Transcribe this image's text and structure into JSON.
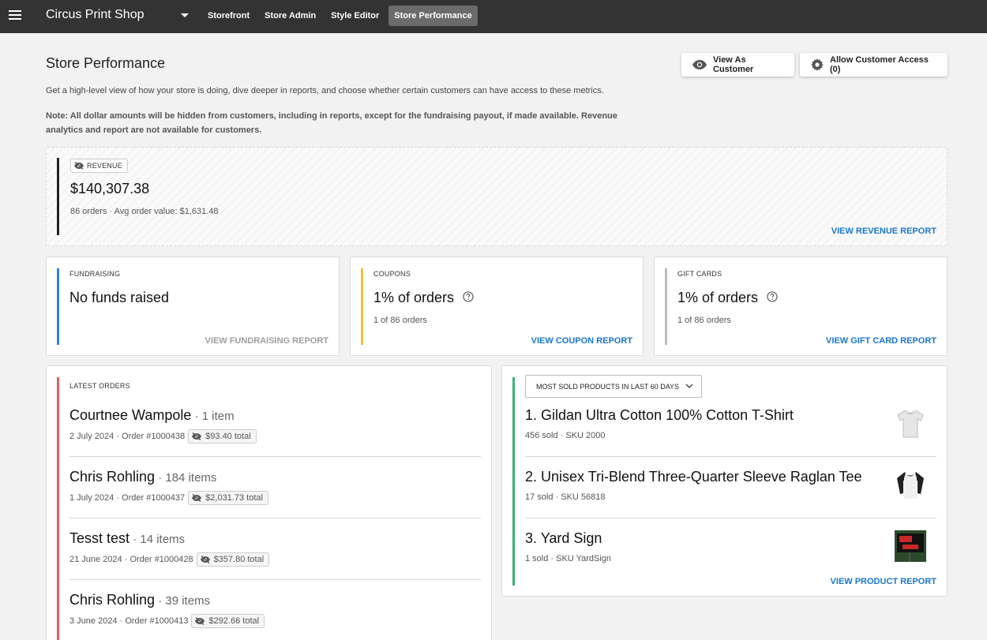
{
  "topbar": {
    "shop_name": "Circus Print Shop",
    "nav": [
      "Storefront",
      "Store Admin",
      "Style Editor",
      "Store Performance"
    ],
    "active_nav": "Store Performance"
  },
  "header": {
    "title": "Store Performance",
    "view_as_customer": "View As Customer",
    "allow_access": "Allow Customer Access (0)",
    "description": "Get a high-level view of how your store is doing, dive deeper in reports, and choose whether certain customers can have access to these metrics.",
    "note": "Note: All dollar amounts will be hidden from customers, including in reports, except for the fundraising payout, if made available. Revenue analytics and report are not available for customers."
  },
  "revenue": {
    "label": "REVENUE",
    "amount": "$140,307.38",
    "sub": "86 orders · Avg order value: $1,631.48",
    "link": "VIEW REVENUE REPORT"
  },
  "fundraising": {
    "label": "FUNDRAISING",
    "value": "No funds raised",
    "link": "VIEW FUNDRAISING REPORT"
  },
  "coupons": {
    "label": "COUPONS",
    "value": "1% of orders",
    "sub": "1 of 86 orders",
    "link": "VIEW COUPON REPORT"
  },
  "gift_cards": {
    "label": "GIFT CARDS",
    "value": "1% of orders",
    "sub": "1 of 86 orders",
    "link": "VIEW GIFT CARD REPORT"
  },
  "latest_orders": {
    "label": "LATEST ORDERS",
    "orders": [
      {
        "name": "Courtnee Wampole",
        "count": " · 1 item",
        "meta": "2 July 2024 · Order #1000438",
        "total": "$93.40 total"
      },
      {
        "name": "Chris Rohling",
        "count": " · 184 items",
        "meta": "1 July 2024 · Order #1000437",
        "total": "$2,031.73 total"
      },
      {
        "name": "Tesst test",
        "count": " · 14 items",
        "meta": "21 June 2024 · Order #1000428",
        "total": "$357.80 total"
      },
      {
        "name": "Chris Rohling",
        "count": " · 39 items",
        "meta": "3 June 2024 · Order #1000413",
        "total": "$292.66 total"
      }
    ]
  },
  "products": {
    "dropdown": "MOST SOLD PRODUCTS IN LAST 60 DAYS",
    "items": [
      {
        "name": "1. Gildan Ultra Cotton 100% Cotton T-Shirt",
        "meta": "456 sold · SKU 2000"
      },
      {
        "name": "2. Unisex Tri-Blend Three-Quarter Sleeve Raglan Tee",
        "meta": "17 sold · SKU 56818"
      },
      {
        "name": "3. Yard Sign",
        "meta": "1 sold · SKU YardSign"
      }
    ],
    "link": "VIEW PRODUCT REPORT"
  },
  "colors": {
    "revenue_accent": "#222222",
    "fundraising_accent": "#2f80ed",
    "coupons_accent": "#f2c12e",
    "gift_cards_accent": "#bdbdbd",
    "orders_accent": "#e35d5d",
    "products_accent": "#3cb371",
    "link": "#1976d2"
  }
}
